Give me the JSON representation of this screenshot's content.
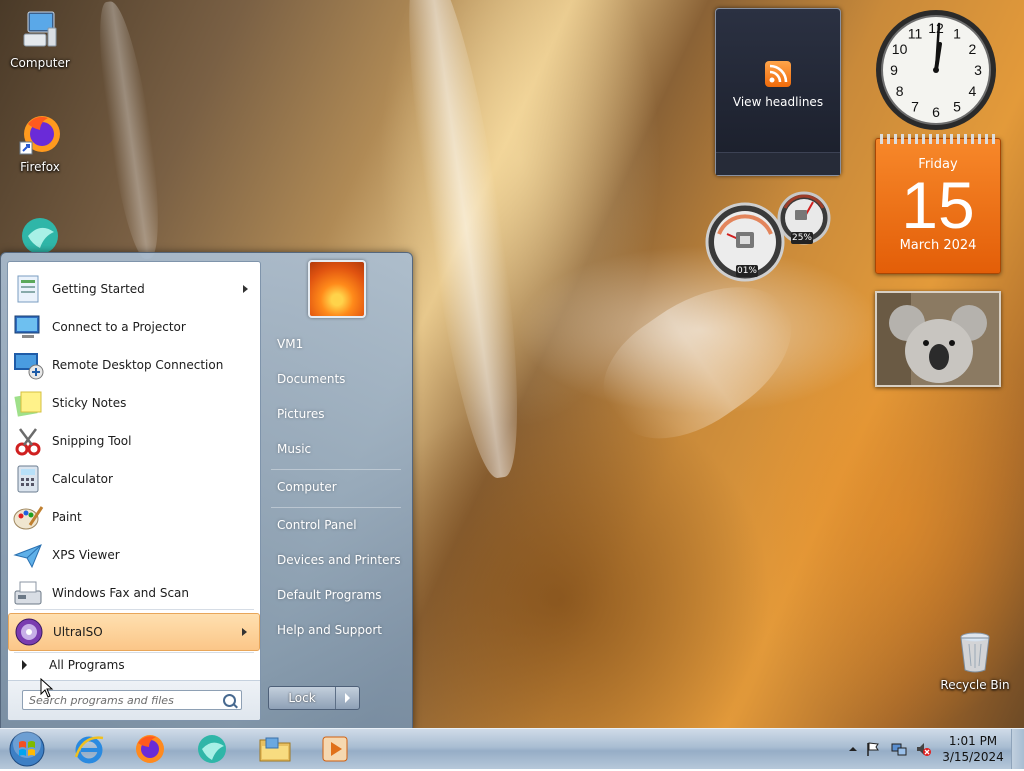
{
  "desktop": {
    "icons": [
      {
        "label": "Computer"
      },
      {
        "label": "Firefox"
      },
      {
        "label": ""
      },
      {
        "label": "Recycle Bin"
      }
    ]
  },
  "gadgets": {
    "feed": {
      "label": "View headlines"
    },
    "calendar": {
      "weekday": "Friday",
      "day": "15",
      "month_year": "March 2024"
    },
    "meter": {
      "cpu": "01%",
      "memory": "25%"
    },
    "clock": {
      "numbers": [
        "12",
        "1",
        "2",
        "3",
        "4",
        "5",
        "6",
        "7",
        "8",
        "9",
        "10",
        "11"
      ]
    }
  },
  "start_menu": {
    "programs": [
      {
        "label": "Getting Started",
        "has_submenu": true
      },
      {
        "label": "Connect to a Projector"
      },
      {
        "label": "Remote Desktop Connection"
      },
      {
        "label": "Sticky Notes"
      },
      {
        "label": "Snipping Tool"
      },
      {
        "label": "Calculator"
      },
      {
        "label": "Paint"
      },
      {
        "label": "XPS Viewer"
      },
      {
        "label": "Windows Fax and Scan"
      },
      {
        "label": "UltraISO",
        "has_submenu": true,
        "selected": true
      }
    ],
    "all_programs": "All Programs",
    "search_placeholder": "Search programs and files",
    "right_items": [
      {
        "label": "VM1"
      },
      {
        "label": "Documents"
      },
      {
        "label": "Pictures"
      },
      {
        "label": "Music"
      },
      {
        "label": "Computer"
      },
      {
        "label": "Control Panel"
      },
      {
        "label": "Devices and Printers"
      },
      {
        "label": "Default Programs"
      },
      {
        "label": "Help and Support"
      }
    ],
    "lock_label": "Lock"
  },
  "taskbar": {
    "time": "1:01 PM",
    "date": "3/15/2024"
  },
  "colors": {
    "accent_orange": "#e35e08",
    "taskbar": "#a9bdd2",
    "selected_item": "#fbc688"
  }
}
